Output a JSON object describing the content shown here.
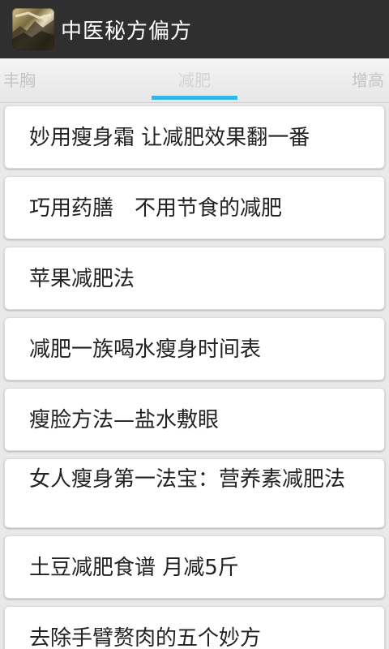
{
  "header": {
    "title": "中医秘方偏方",
    "icon": "app-logo-icon"
  },
  "tabs": [
    {
      "label": "丰胸"
    },
    {
      "label": "减肥",
      "selected": true
    },
    {
      "label": "增高"
    }
  ],
  "list": {
    "items": [
      {
        "title": "妙用瘦身霜 让减肥效果翻一番"
      },
      {
        "title": "巧用药膳　不用节食的减肥"
      },
      {
        "title": "苹果减肥法"
      },
      {
        "title": "减肥一族喝水瘦身时间表"
      },
      {
        "title": "瘦脸方法—盐水敷眼"
      },
      {
        "title": "女人瘦身第一法宝：营养素减肥法"
      },
      {
        "title": "土豆减肥食谱 月减5斤"
      },
      {
        "title": "去除手臂赘肉的五个妙方"
      }
    ]
  },
  "colors": {
    "action_bar": "#2f2f2f",
    "tab_indicator": "#33b5e5",
    "background": "#e9e9e9"
  }
}
